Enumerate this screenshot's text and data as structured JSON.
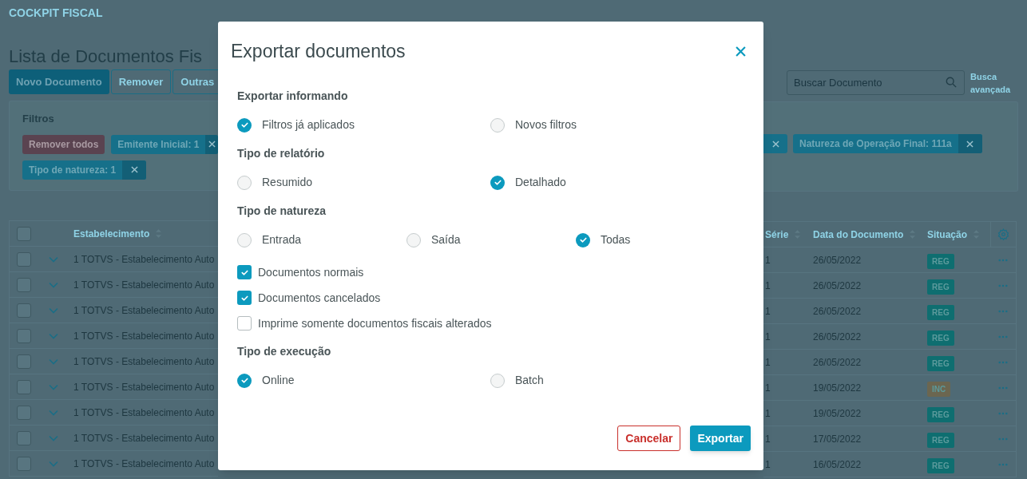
{
  "app_title": "COCKPIT FISCAL",
  "page_title": "Lista de Documentos Fis",
  "toolbar": {
    "buttons": [
      {
        "label": "Novo Documento",
        "kind": "primary"
      },
      {
        "label": "Remover",
        "kind": "secondary"
      },
      {
        "label": "Outras",
        "kind": "secondary"
      }
    ]
  },
  "search": {
    "placeholder": "Buscar Documento"
  },
  "advanced_search": "Busca avançada",
  "filters": {
    "title": "Filtros",
    "rows": [
      [
        {
          "kind": "clear",
          "label": "Remover todos"
        },
        {
          "kind": "filter",
          "label": "Emitente Inicial: 1"
        },
        {
          "kind": "close_only"
        },
        {
          "kind": "filter",
          "label": "Natureza de Operação Final: 111a"
        }
      ],
      [
        {
          "kind": "filter",
          "label": "Tipo de natureza: 1"
        }
      ]
    ]
  },
  "table": {
    "select_all_checked": false,
    "columns": [
      "Estabelecimento",
      "Série",
      "Data do Documento",
      "Situação"
    ],
    "rows": [
      {
        "checked": false,
        "establishment": "1 TOTVS - Estabelecimento Auto",
        "serie": "1",
        "date": "26/05/2022",
        "status": {
          "label": "REG",
          "color": "#0e6e70"
        }
      },
      {
        "checked": false,
        "establishment": "1 TOTVS - Estabelecimento Auto",
        "serie": "1",
        "date": "26/05/2022",
        "status": {
          "label": "REG",
          "color": "#0e6e70"
        }
      },
      {
        "checked": false,
        "establishment": "1 TOTVS - Estabelecimento Auto",
        "serie": "1",
        "date": "26/05/2022",
        "status": {
          "label": "REG",
          "color": "#0e6e70"
        }
      },
      {
        "checked": false,
        "establishment": "1 TOTVS - Estabelecimento Auto",
        "serie": "1",
        "date": "26/05/2022",
        "status": {
          "label": "REG",
          "color": "#0e6e70"
        }
      },
      {
        "checked": false,
        "establishment": "1 TOTVS - Estabelecimento Auto",
        "serie": "1",
        "date": "26/05/2022",
        "status": {
          "label": "REG",
          "color": "#0e6e70"
        }
      },
      {
        "checked": false,
        "establishment": "1 TOTVS - Estabelecimento Auto",
        "serie": "1",
        "date": "19/05/2022",
        "status": {
          "label": "INC",
          "color": "#6b6650"
        }
      },
      {
        "checked": false,
        "establishment": "1 TOTVS - Estabelecimento Auto",
        "serie": "1",
        "date": "19/05/2022",
        "status": {
          "label": "REG",
          "color": "#0e6e70"
        }
      },
      {
        "checked": false,
        "establishment": "1 TOTVS - Estabelecimento Auto",
        "serie": "1",
        "date": "17/05/2022",
        "status": {
          "label": "REG",
          "color": "#0e6e70"
        }
      },
      {
        "checked": false,
        "establishment": "1 TOTVS - Estabelecimento Auto",
        "serie": "1",
        "date": "16/05/2022",
        "status": {
          "label": "REG",
          "color": "#0e6e70"
        }
      }
    ]
  },
  "dialog": {
    "title": "Exportar documentos",
    "sections": [
      {
        "kind": "radio",
        "title": "Exportar informando",
        "options": [
          {
            "label": "Filtros já aplicados",
            "selected": true
          },
          {
            "label": "Novos filtros",
            "selected": false
          }
        ]
      },
      {
        "kind": "radio",
        "title": "Tipo de relatório",
        "options": [
          {
            "label": "Resumido",
            "selected": false
          },
          {
            "label": "Detalhado",
            "selected": true
          }
        ]
      },
      {
        "kind": "radio",
        "title": "Tipo de natureza",
        "options": [
          {
            "label": "Entrada",
            "selected": false
          },
          {
            "label": "Saída",
            "selected": false
          },
          {
            "label": "Todas",
            "selected": true
          }
        ]
      },
      {
        "kind": "checkbox",
        "options": [
          {
            "label": "Documentos normais",
            "checked": true
          },
          {
            "label": "Documentos cancelados",
            "checked": true
          },
          {
            "label": "Imprime somente documentos fiscais alterados",
            "checked": false
          }
        ]
      },
      {
        "kind": "radio",
        "title": "Tipo de execução",
        "options": [
          {
            "label": "Online",
            "selected": true
          },
          {
            "label": "Batch",
            "selected": false
          }
        ]
      }
    ],
    "buttons": [
      {
        "label": "Cancelar",
        "kind": "secondary"
      },
      {
        "label": "Exportar",
        "kind": "primary"
      }
    ]
  }
}
